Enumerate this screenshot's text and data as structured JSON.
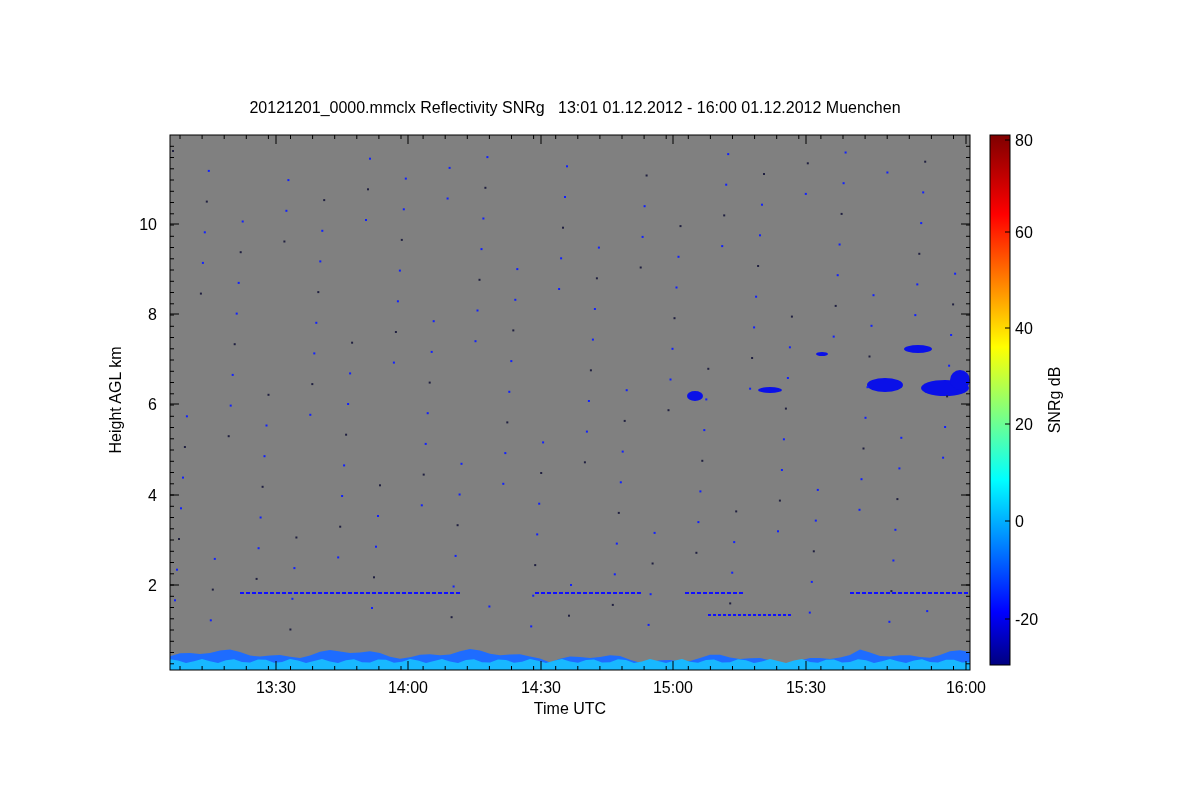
{
  "title": "20121201_0000.mmclx Reflectivity SNRg   13:01 01.12.2012 - 16:00 01.12.2012 Muenchen",
  "plot": {
    "xlabel": "Time UTC",
    "ylabel": "Height AGL km",
    "xticks": [
      "13:30",
      "14:00",
      "14:30",
      "15:00",
      "15:30",
      "16:00"
    ],
    "yticks": [
      "10",
      "8",
      "6",
      "4",
      "2"
    ]
  },
  "colorbar": {
    "label": "SNRg dB",
    "ticks": [
      "80",
      "60",
      "40",
      "20",
      "0",
      "-20"
    ]
  }
}
